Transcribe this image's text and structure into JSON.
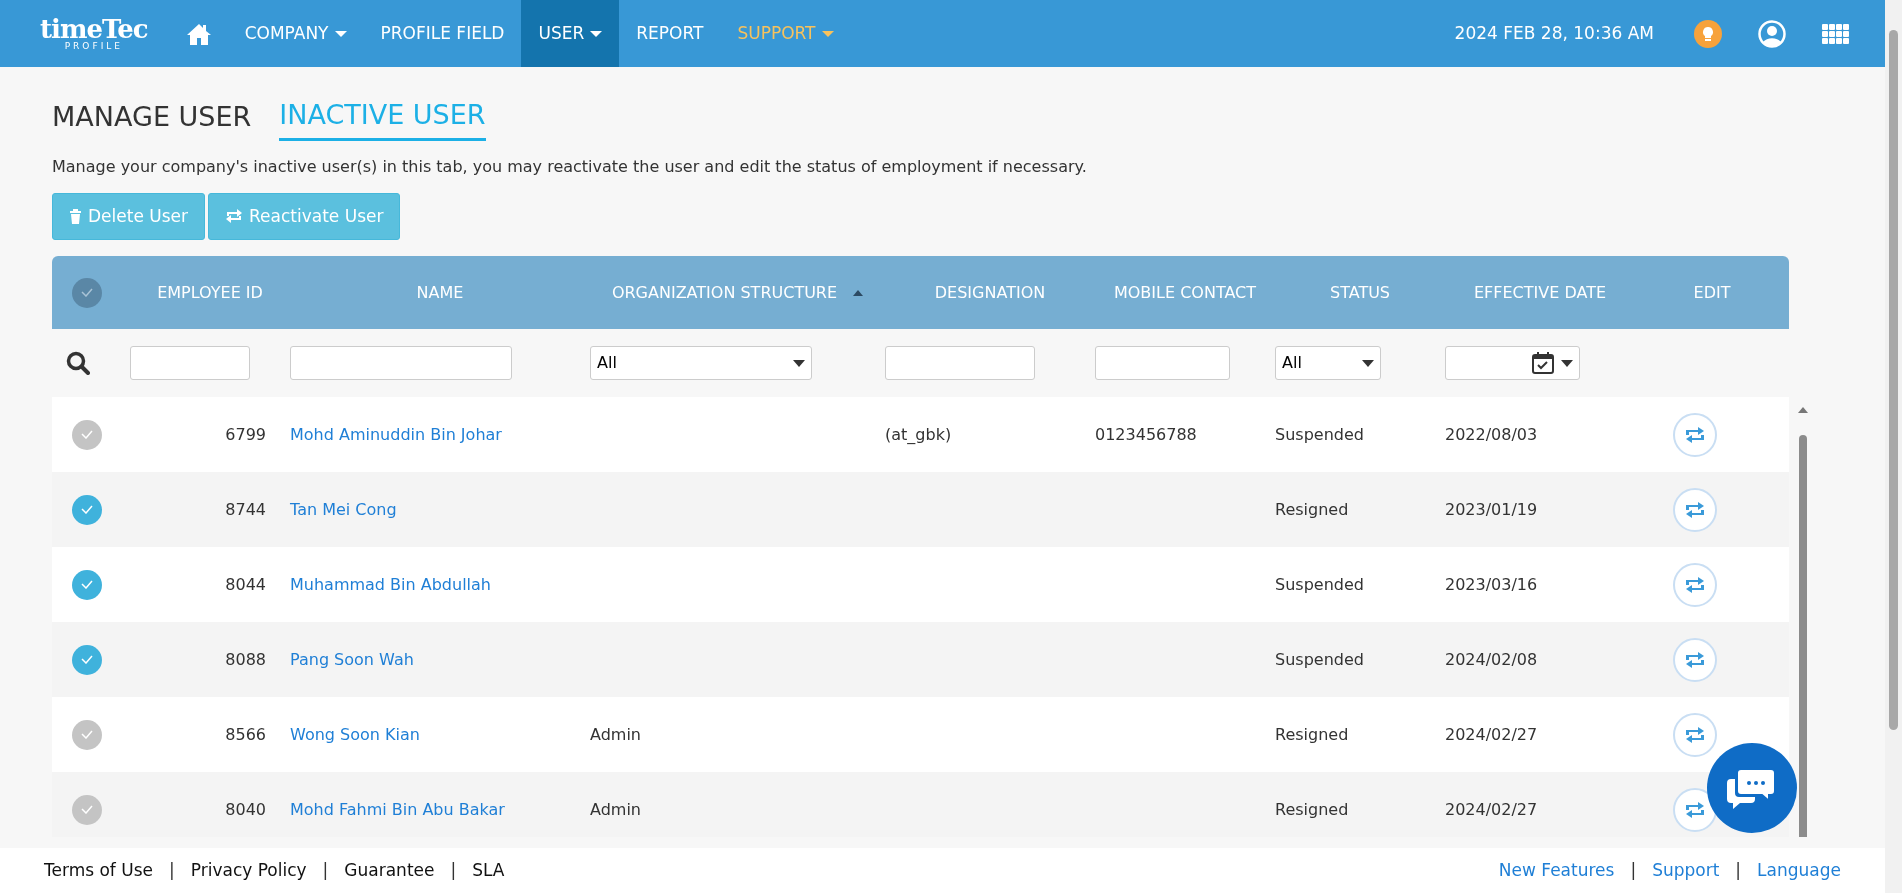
{
  "navbar": {
    "logo": {
      "main": "timeTec",
      "sub": "PROFILE"
    },
    "items": [
      {
        "label": "COMPANY",
        "dropdown": true,
        "selected": false,
        "accent": false
      },
      {
        "label": "PROFILE FIELD",
        "dropdown": false,
        "selected": false,
        "accent": false
      },
      {
        "label": "USER",
        "dropdown": true,
        "selected": true,
        "accent": false
      },
      {
        "label": "REPORT",
        "dropdown": false,
        "selected": false,
        "accent": false
      },
      {
        "label": "SUPPORT",
        "dropdown": true,
        "selected": false,
        "accent": true
      }
    ],
    "datetime": "2024 FEB 28, 10:36 AM"
  },
  "tabs": [
    {
      "label": "MANAGE USER",
      "selected": false
    },
    {
      "label": "INACTIVE USER",
      "selected": true
    }
  ],
  "description": "Manage your company's inactive user(s) in this tab, you may reactivate the user and edit the status of employment if necessary.",
  "buttons": [
    {
      "label": "Delete User",
      "kind": "delete"
    },
    {
      "label": "Reactivate User",
      "kind": "reactivate"
    }
  ],
  "table": {
    "select_all_checked": false,
    "columns": [
      {
        "label": "EMPLOYEE ID",
        "sorted": false
      },
      {
        "label": "NAME",
        "sorted": false
      },
      {
        "label": "ORGANIZATION STRUCTURE",
        "sorted": true
      },
      {
        "label": "DESIGNATION",
        "sorted": false
      },
      {
        "label": "MOBILE CONTACT",
        "sorted": false
      },
      {
        "label": "STATUS",
        "sorted": false
      },
      {
        "label": "EFFECTIVE DATE",
        "sorted": false
      },
      {
        "label": "EDIT",
        "sorted": false
      }
    ],
    "filters": [
      {
        "kind": "text"
      },
      {
        "kind": "text"
      },
      {
        "kind": "select",
        "value": "All"
      },
      {
        "kind": "text"
      },
      {
        "kind": "text"
      },
      {
        "kind": "select",
        "value": "All"
      },
      {
        "kind": "date"
      },
      {
        "kind": "none"
      }
    ],
    "rows": [
      {
        "checked": false,
        "employee_id": "6799",
        "name": "Mohd Aminuddin Bin Johar",
        "designation": "(at_gbk)",
        "mobile": "0123456788",
        "status": "Suspended",
        "effective_date": "2022/08/03"
      },
      {
        "checked": true,
        "employee_id": "8744",
        "name": "Tan Mei Cong",
        "status": "Resigned",
        "effective_date": "2023/01/19"
      },
      {
        "checked": true,
        "employee_id": "8044",
        "name": "Muhammad Bin Abdullah",
        "status": "Suspended",
        "effective_date": "2023/03/16"
      },
      {
        "checked": true,
        "employee_id": "8088",
        "name": "Pang Soon Wah",
        "status": "Suspended",
        "effective_date": "2024/02/08"
      },
      {
        "checked": false,
        "employee_id": "8566",
        "name": "Wong Soon Kian",
        "organization": "Admin",
        "status": "Resigned",
        "effective_date": "2024/02/27"
      },
      {
        "checked": false,
        "employee_id": "8040",
        "name": "Mohd Fahmi Bin Abu Bakar",
        "organization": "Admin",
        "status": "Resigned",
        "effective_date": "2024/02/27"
      }
    ]
  },
  "footer": {
    "left_links": [
      "Terms of Use",
      "Privacy Policy",
      "Guarantee",
      "SLA"
    ],
    "right_links": [
      "New Features",
      "Support",
      "Language"
    ],
    "separator": "|"
  }
}
